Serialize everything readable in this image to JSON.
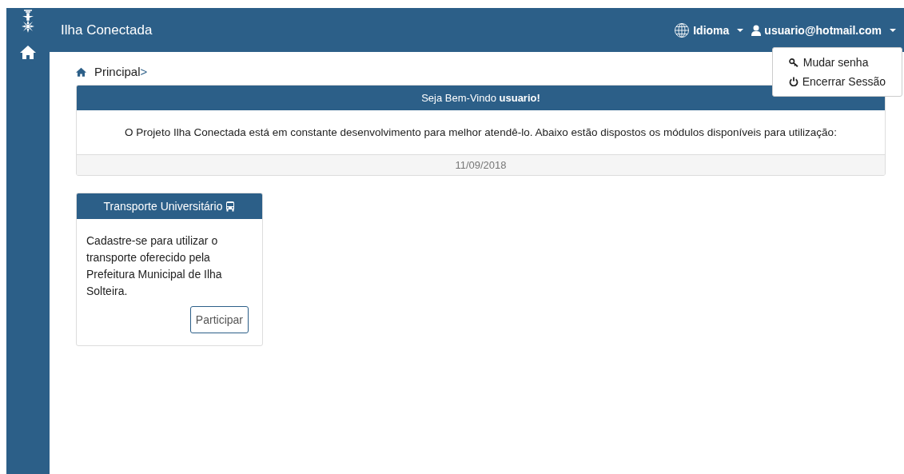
{
  "navbar": {
    "title": "Ilha Conectada",
    "language_menu": "Idioma",
    "user_menu": "usuario@hotmail.com"
  },
  "user_dropdown": {
    "items": [
      {
        "kind": "password",
        "label": "Mudar senha"
      },
      {
        "kind": "logout",
        "label": "Encerrar Sessão"
      }
    ]
  },
  "breadcrumb": {
    "label": "Principal",
    "separator": ">"
  },
  "welcome_panel": {
    "heading": "Seja Bem-Vindo **usuario!**",
    "message": "O Projeto Ilha Conectada está em constante desenvolvimento para melhor atendê-lo. Abaixo estão dispostos os módulos disponíveis para utilização:",
    "date": "11/09/2018"
  },
  "modules": [
    {
      "title": "Transporte Universitário",
      "description": "Cadastre-se para utilizar o transporte oferecido pela Prefeitura Municipal de Ilha Solteira.",
      "button": "Participar"
    }
  ]
}
